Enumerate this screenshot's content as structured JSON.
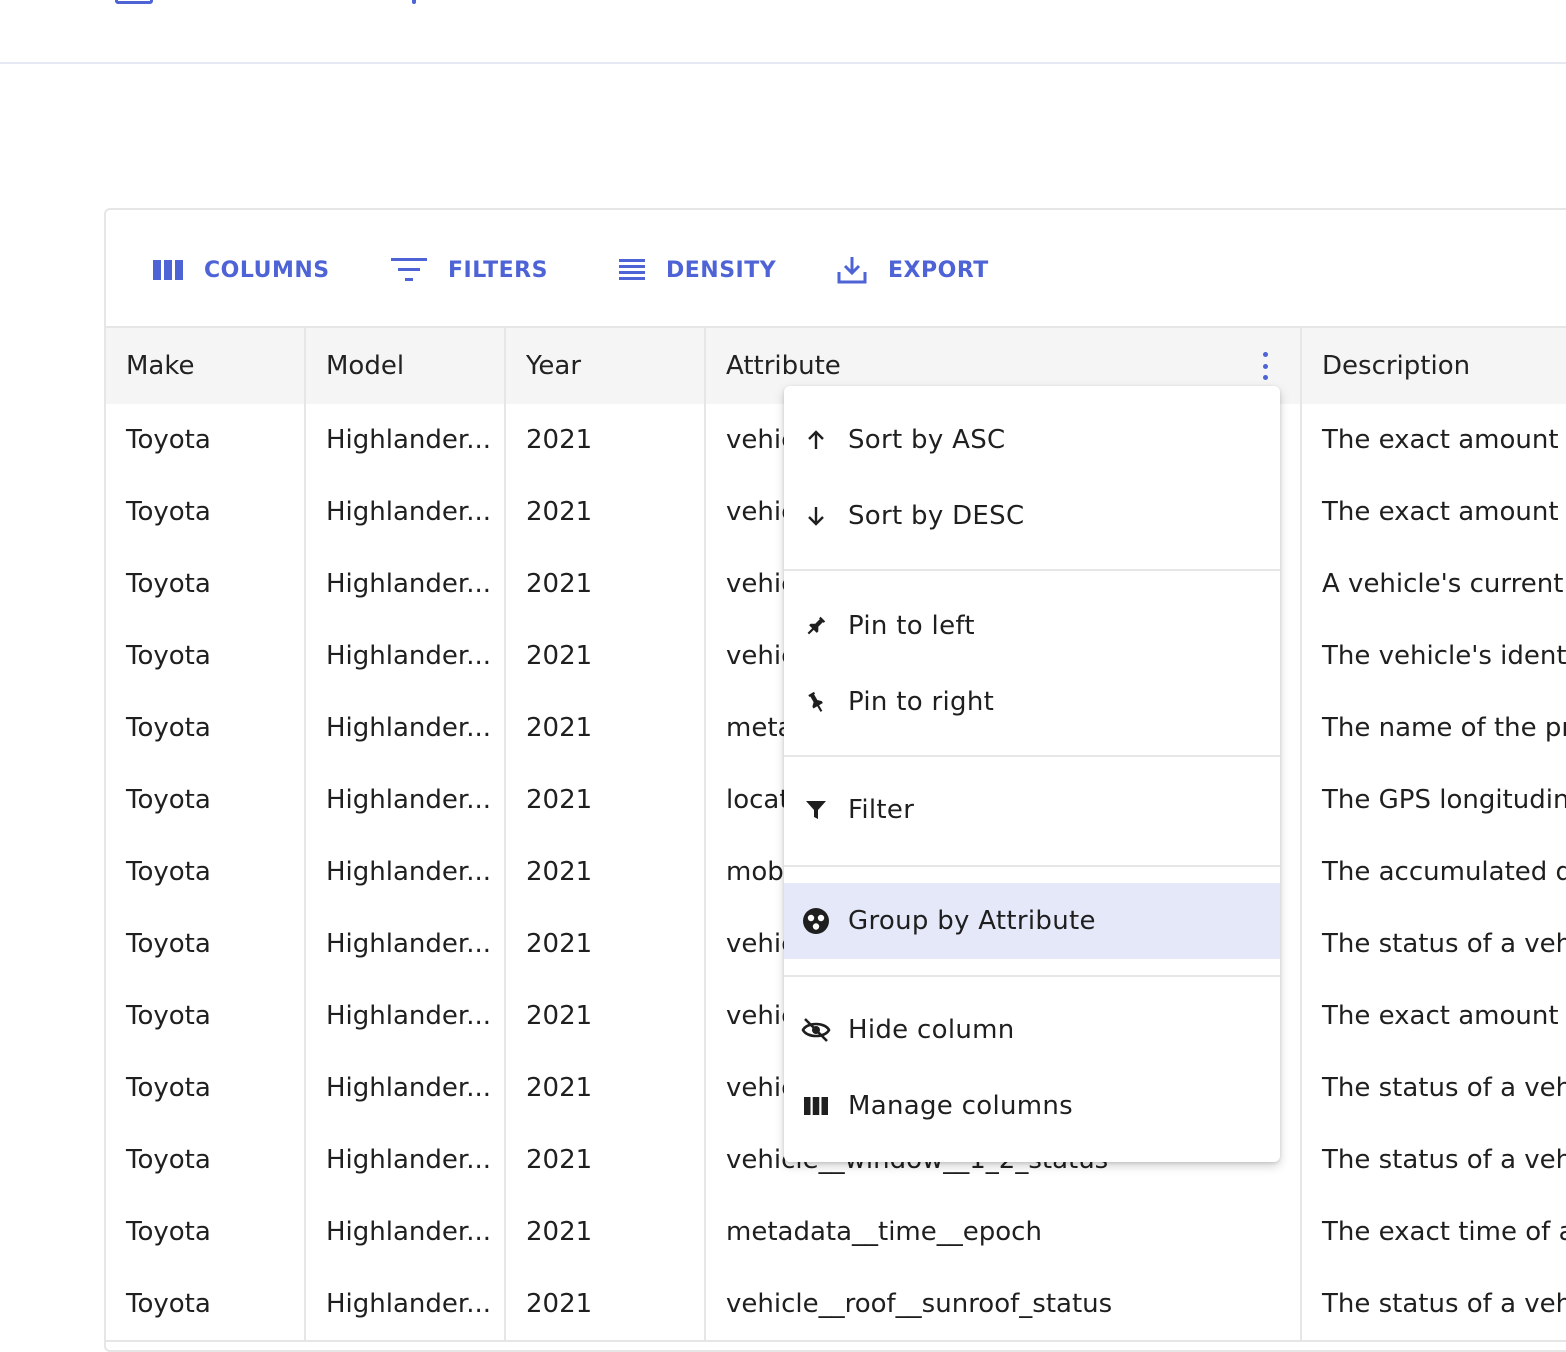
{
  "toolbar": {
    "columns_label": "COLUMNS",
    "filters_label": "FILTERS",
    "density_label": "DENSITY",
    "export_label": "EXPORT"
  },
  "headers": [
    "Make",
    "Model",
    "Year",
    "Attribute",
    "Description"
  ],
  "rows": [
    {
      "make": "Toyota",
      "model": "Highlander...",
      "year": "2021",
      "attribute": "vehic",
      "description": "The exact amount c"
    },
    {
      "make": "Toyota",
      "model": "Highlander...",
      "year": "2021",
      "attribute": "vehic",
      "description": "The exact amount c"
    },
    {
      "make": "Toyota",
      "model": "Highlander...",
      "year": "2021",
      "attribute": "vehic",
      "description": "A vehicle's current f"
    },
    {
      "make": "Toyota",
      "model": "Highlander...",
      "year": "2021",
      "attribute": "vehic",
      "description": "The vehicle's identif"
    },
    {
      "make": "Toyota",
      "model": "Highlander...",
      "year": "2021",
      "attribute": "meta",
      "description": "The name of the pr"
    },
    {
      "make": "Toyota",
      "model": "Highlander...",
      "year": "2021",
      "attribute": "locat",
      "description": "The GPS longitudina"
    },
    {
      "make": "Toyota",
      "model": "Highlander...",
      "year": "2021",
      "attribute": "mobi",
      "description": "The accumulated di"
    },
    {
      "make": "Toyota",
      "model": "Highlander...",
      "year": "2021",
      "attribute": "vehic",
      "description": "The status of a vehi"
    },
    {
      "make": "Toyota",
      "model": "Highlander...",
      "year": "2021",
      "attribute": "vehic",
      "description": "The exact amount c"
    },
    {
      "make": "Toyota",
      "model": "Highlander...",
      "year": "2021",
      "attribute": "vehic",
      "description": "The status of a vehi"
    },
    {
      "make": "Toyota",
      "model": "Highlander...",
      "year": "2021",
      "attribute": "vehicle__window__1_2_status",
      "description": "The status of a vehi"
    },
    {
      "make": "Toyota",
      "model": "Highlander...",
      "year": "2021",
      "attribute": "metadata__time__epoch",
      "description": "The exact time of a"
    },
    {
      "make": "Toyota",
      "model": "Highlander...",
      "year": "2021",
      "attribute": "vehicle__roof__sunroof_status",
      "description": "The status of a vehi"
    }
  ],
  "menu": {
    "sort_asc": "Sort by ASC",
    "sort_desc": "Sort by DESC",
    "pin_left": "Pin to left",
    "pin_right": "Pin to right",
    "filter": "Filter",
    "group_by": "Group by Attribute",
    "hide_column": "Hide column",
    "manage_columns": "Manage columns"
  },
  "colors": {
    "accent": "#4d63d6",
    "selected_item_bg": "#e4e8f9",
    "header_bg": "#f5f5f5",
    "border": "#e6e6e6"
  },
  "icons": {
    "columns": "columns-icon",
    "filters": "filter-list-icon",
    "density": "density-icon",
    "export": "export-icon",
    "column_menu": "more-vertical-icon",
    "sort_asc": "arrow-up-icon",
    "sort_desc": "arrow-down-icon",
    "pin_left": "pin-icon",
    "pin_right": "pin-icon",
    "filter": "funnel-icon",
    "group_by": "group-icon",
    "hide": "eye-off-icon",
    "manage": "columns-icon"
  }
}
